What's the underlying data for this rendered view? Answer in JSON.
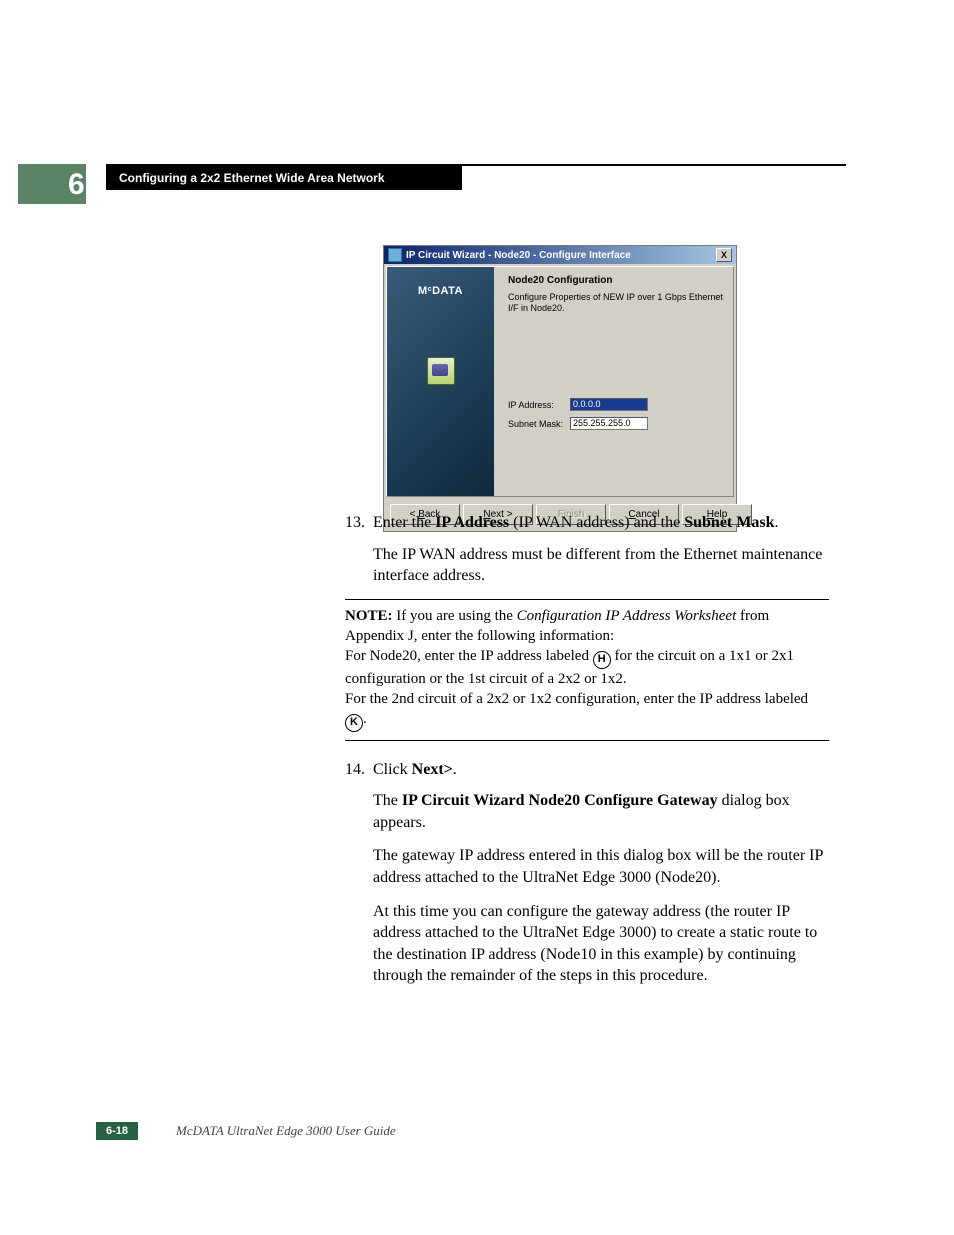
{
  "chapter_number": "6",
  "section_header": "Configuring a 2x2 Ethernet Wide Area Network",
  "dialog": {
    "title": "IP Circuit Wizard - Node20 - Configure Interface",
    "brand_line1": "M",
    "brand_sup": "c",
    "brand_line2": "DATA",
    "cfg_title": "Node20 Configuration",
    "cfg_desc": "Configure Properties of NEW IP over 1 Gbps Ethernet I/F in Node20.",
    "ip_label": "IP Address:",
    "ip_value": "0.0.0.0",
    "mask_label": "Subnet Mask:",
    "mask_value": "255.255.255.0",
    "btn_back": "< Back",
    "btn_next": "Next >",
    "btn_finish": "Finish",
    "btn_cancel": "Cancel",
    "btn_help": "Help",
    "close_x": "X"
  },
  "step13": {
    "num": "13.",
    "pre": "Enter the ",
    "b1": "IP Address",
    "mid": " (IP WAN address) and the ",
    "b2": "Subnet Mask",
    "end": ".",
    "para2": "The IP WAN address must be different from the Ethernet maintenance interface address."
  },
  "note": {
    "label": "NOTE: ",
    "line1_a": "If you are using the ",
    "line1_i": "Configuration IP Address Worksheet",
    "line1_b": " from Appendix J, enter the following information:",
    "line2_a": "For Node20, enter the IP address labeled ",
    "circ_h": "H",
    "line2_b": " for the circuit on a 1x1 or 2x1 configuration or the 1st circuit of a 2x2 or 1x2.",
    "line3_a": "For the 2nd circuit of a 2x2 or 1x2 configuration, enter the IP address labeled ",
    "circ_k": "K",
    "line3_b": "."
  },
  "step14": {
    "num": "14.",
    "pre": "Click ",
    "b1": "Next>",
    "end": ".",
    "p2_a": "The ",
    "p2_b": "IP Circuit Wizard Node20 Configure Gateway",
    "p2_c": " dialog box appears.",
    "p3": "The gateway IP address entered in this dialog box will be the router IP address attached to the UltraNet Edge 3000 (Node20).",
    "p4": "At this time you can configure the gateway address (the router IP address attached to the UltraNet Edge 3000) to create a static route to the destination IP address (Node10 in this example) by continuing through the remainder of the steps in this procedure."
  },
  "footer": {
    "page": "6-18",
    "guide": "McDATA UltraNet Edge 3000 User Guide"
  }
}
